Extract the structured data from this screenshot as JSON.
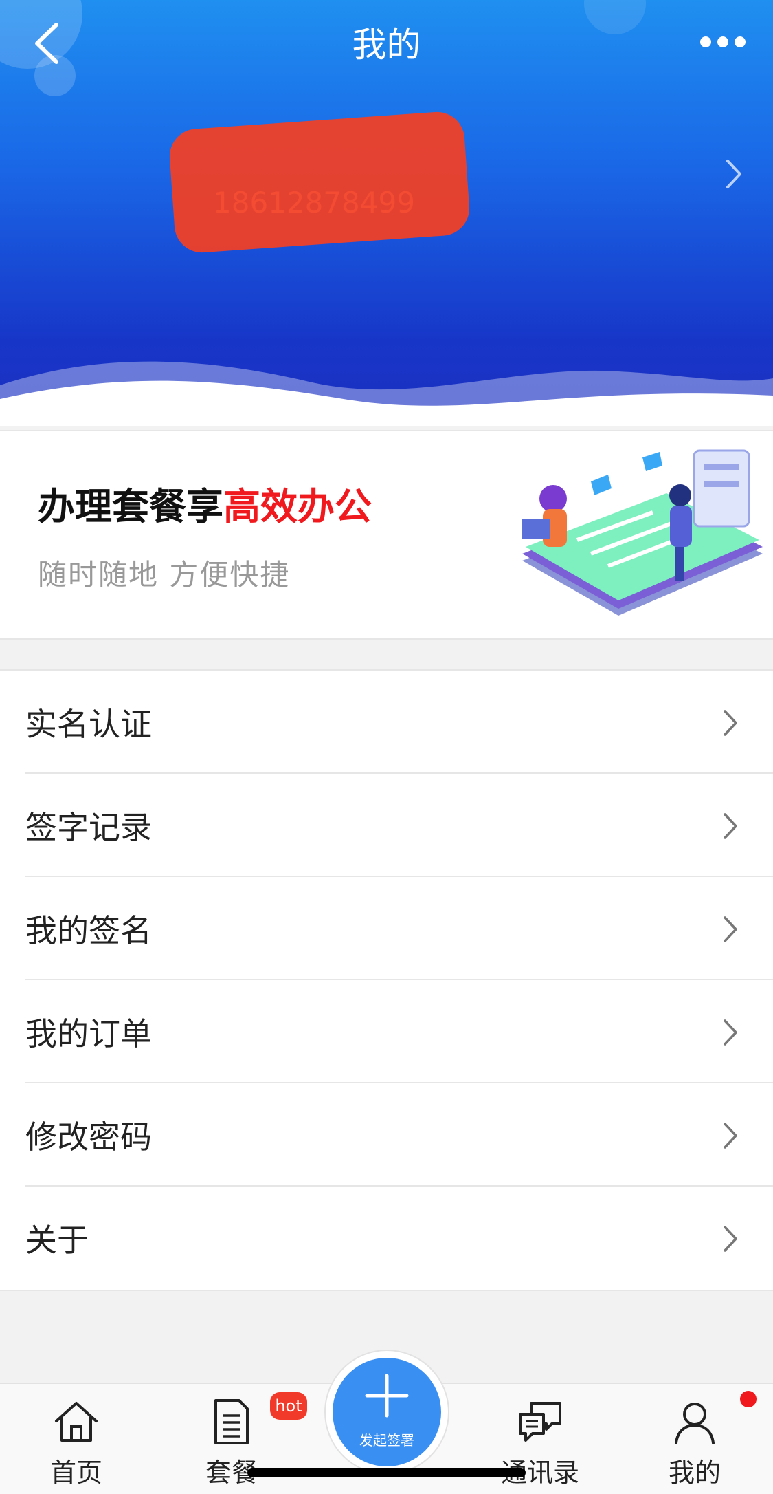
{
  "header": {
    "title": "我的",
    "user_phone": "18612878499"
  },
  "promo": {
    "title_prefix": "办理套餐享",
    "title_highlight": "高效办公",
    "subtitle": "随时随地  方便快捷"
  },
  "menu": {
    "items": [
      {
        "label": "实名认证"
      },
      {
        "label": "签字记录"
      },
      {
        "label": "我的签名"
      },
      {
        "label": "我的订单"
      },
      {
        "label": "修改密码"
      },
      {
        "label": "关于"
      }
    ]
  },
  "tabbar": {
    "home": "首页",
    "package": "套餐",
    "hot_badge": "hot",
    "center": "发起签署",
    "contacts": "通讯录",
    "mine": "我的"
  },
  "colors": {
    "header_blue": "#1a66e6",
    "highlight_red": "#f0191e",
    "center_button": "#3a8ff2"
  }
}
